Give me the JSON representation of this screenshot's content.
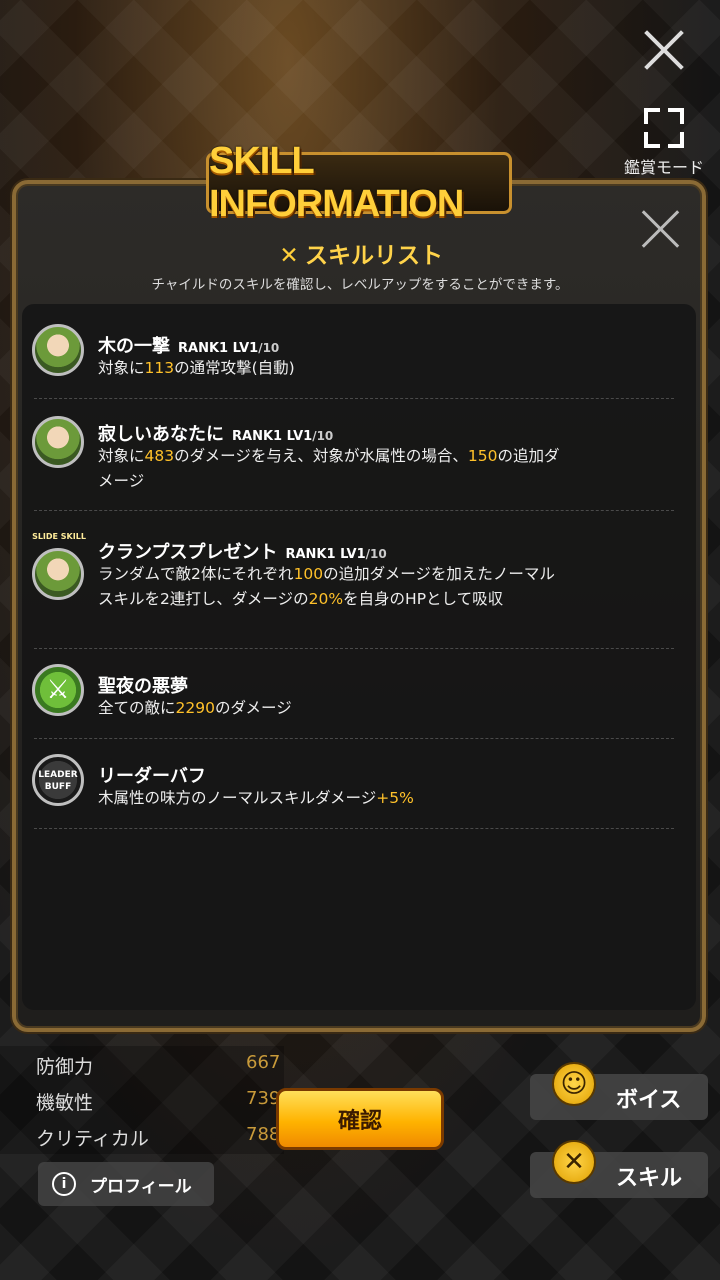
{
  "top": {
    "view_mode_label": "鑑賞モード"
  },
  "panel": {
    "banner": "SKILL INFORMATION",
    "title": "スキルリスト",
    "subtitle": "チャイルドのスキルを確認し、レベルアップをすることができます。"
  },
  "skills": [
    {
      "name": "木の一撃",
      "rank": "RANK1 LV1",
      "max": "/10",
      "desc": [
        {
          "t": "対象に"
        },
        {
          "t": "113",
          "y": true
        },
        {
          "t": "の通常攻撃(自動)"
        }
      ]
    },
    {
      "name": "寂しいあなたに",
      "rank": "RANK1 LV1",
      "max": "/10",
      "desc": [
        {
          "t": "対象に"
        },
        {
          "t": "483",
          "y": true
        },
        {
          "t": "のダメージを与え、対象が水属性の場合、"
        },
        {
          "t": "150",
          "y": true
        },
        {
          "t": "の追加ダメージ"
        }
      ]
    },
    {
      "badge": "SLIDE SKILL",
      "name": "クランプスプレゼント",
      "rank": "RANK1 LV1",
      "max": "/10",
      "desc": [
        {
          "t": "ランダムで敵2体にそれぞれ"
        },
        {
          "t": "100",
          "y": true
        },
        {
          "t": "の追加ダメージを加えたノーマルスキルを2連打し、ダメージの"
        },
        {
          "t": "20%",
          "y": true
        },
        {
          "t": "を自身のHPとして吸収"
        }
      ]
    },
    {
      "name": "聖夜の悪夢",
      "desc": [
        {
          "t": "全ての敵に"
        },
        {
          "t": "2290",
          "y": true
        },
        {
          "t": "のダメージ"
        }
      ]
    },
    {
      "icon_text": "LEADER BUFF",
      "name": "リーダーバフ",
      "desc": [
        {
          "t": "木属性の味方のノーマルスキルダメージ"
        },
        {
          "t": "+5%",
          "y": true
        }
      ]
    }
  ],
  "stats": [
    {
      "label": "防御力",
      "value": "667"
    },
    {
      "label": "機敏性",
      "value": "739"
    },
    {
      "label": "クリティカル",
      "value": "788"
    }
  ],
  "buttons": {
    "confirm": "確認",
    "profile": "プロフィール",
    "voice": "ボイス",
    "skill": "スキル"
  },
  "icons": {
    "close": "close-icon",
    "fullscreen": "fullscreen-icon",
    "skill_list": "skill-icon",
    "voice": "smiley-icon",
    "info": "info-icon"
  }
}
